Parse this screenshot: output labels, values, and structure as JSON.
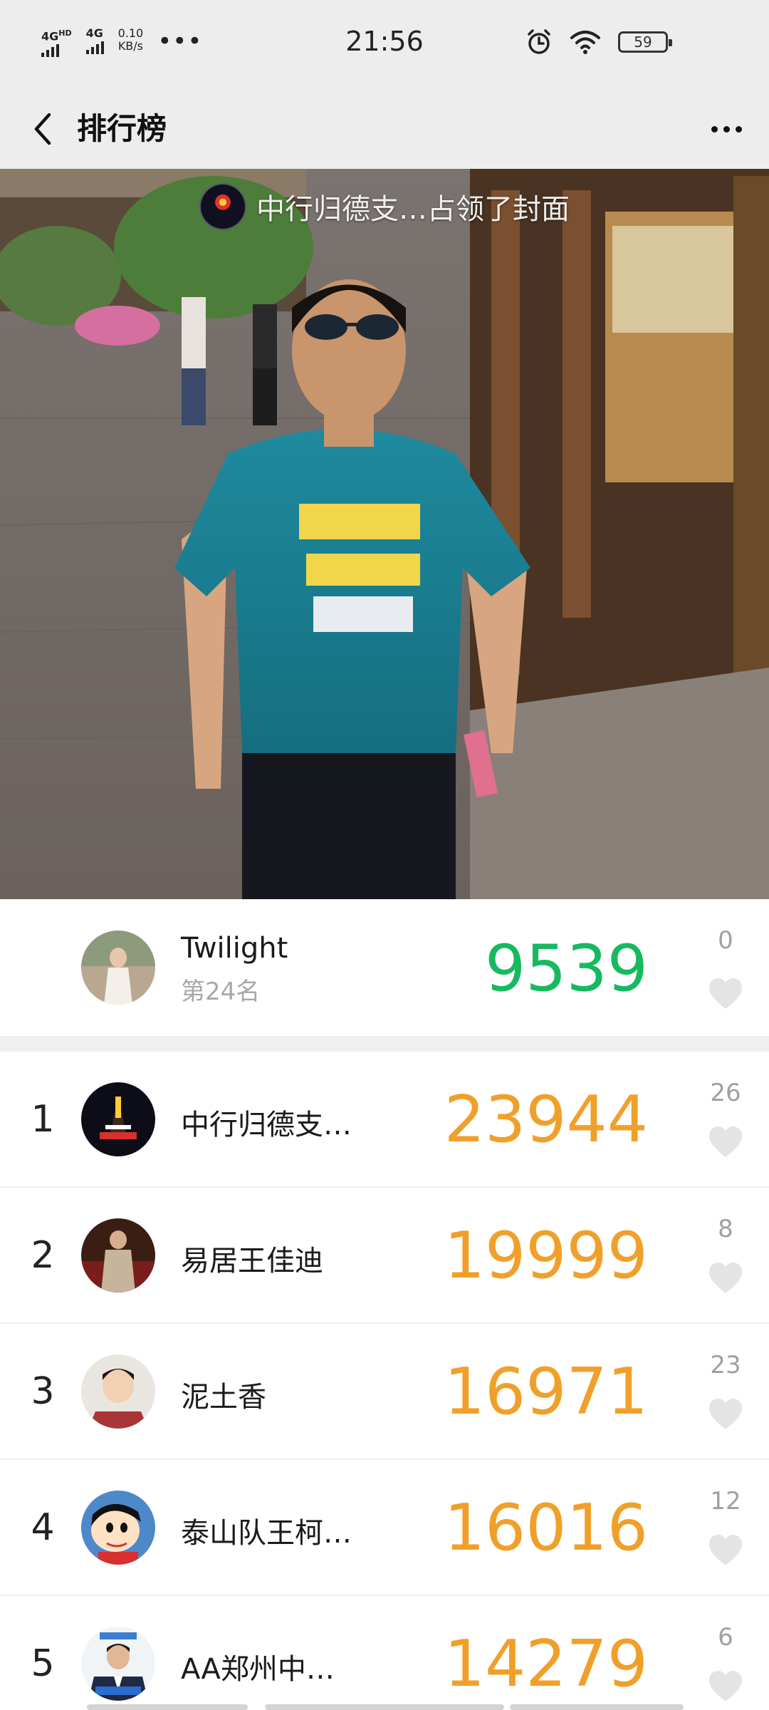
{
  "status_bar": {
    "network1": "4G",
    "network1_sup": "HD",
    "network2": "4G",
    "speed_value": "0.10",
    "speed_unit": "KB/s",
    "overflow": "•••",
    "time": "21:56",
    "battery": "59",
    "icons": [
      "alarm-icon",
      "wifi-icon",
      "battery-icon"
    ]
  },
  "header": {
    "title": "排行榜",
    "back_icon": "chevron-left-icon",
    "more_icon": "more-dots-icon"
  },
  "cover": {
    "owner_text": "中行归德支…占领了封面"
  },
  "my_rank": {
    "name": "Twilight",
    "rank_label": "第24名",
    "steps": "9539",
    "likes": "0"
  },
  "ranking": [
    {
      "rank": "1",
      "name": "中行归德支…",
      "steps": "23944",
      "likes": "26"
    },
    {
      "rank": "2",
      "name": "易居王佳迪",
      "steps": "19999",
      "likes": "8"
    },
    {
      "rank": "3",
      "name": "泥土香",
      "steps": "16971",
      "likes": "23"
    },
    {
      "rank": "4",
      "name": "泰山队王柯…",
      "steps": "16016",
      "likes": "12"
    },
    {
      "rank": "5",
      "name": "AA郑州中…",
      "steps": "14279",
      "likes": "6"
    }
  ],
  "colors": {
    "my_steps": "#17b95f",
    "rank_steps": "#f0a02a",
    "heart": "#e4e4e4",
    "bar_bg": "#ededed"
  }
}
